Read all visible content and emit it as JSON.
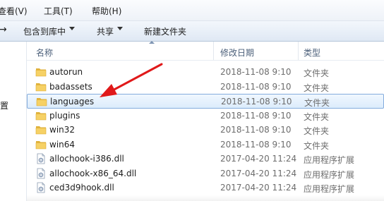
{
  "menubar": {
    "items": [
      "查看(V)",
      "工具(T)",
      "帮助(H)"
    ]
  },
  "toolbar": {
    "include_library": "包含到库中",
    "share": "共享",
    "new_folder": "新建文件夹"
  },
  "left_pane": {
    "partial_text": "置"
  },
  "columns": {
    "name": "名称",
    "modified": "修改日期",
    "type": "类型"
  },
  "rows": [
    {
      "name": "autorun",
      "modified": "2018-11-08 9:10",
      "type": "文件夹",
      "icon": "folder-icon"
    },
    {
      "name": "badassets",
      "modified": "2018-11-08 9:10",
      "type": "文件夹",
      "icon": "folder-icon"
    },
    {
      "name": "languages",
      "modified": "2018-11-08 9:10",
      "type": "文件夹",
      "icon": "folder-icon",
      "selected": true
    },
    {
      "name": "plugins",
      "modified": "2018-11-08 9:10",
      "type": "文件夹",
      "icon": "folder-icon"
    },
    {
      "name": "win32",
      "modified": "2018-11-08 9:10",
      "type": "文件夹",
      "icon": "folder-icon"
    },
    {
      "name": "win64",
      "modified": "2018-11-08 9:10",
      "type": "文件夹",
      "icon": "folder-icon"
    },
    {
      "name": "allochook-i386.dll",
      "modified": "2017-04-20 11:24",
      "type": "应用程序扩展",
      "icon": "dll-file-icon"
    },
    {
      "name": "allochook-x86_64.dll",
      "modified": "2017-04-20 11:24",
      "type": "应用程序扩展",
      "icon": "dll-file-icon"
    },
    {
      "name": "ced3d9hook.dll",
      "modified": "2017-04-20 11:24",
      "type": "应用程序扩展",
      "icon": "dll-file-icon"
    }
  ],
  "colors": {
    "arrow": "#e0191a",
    "selection_border": "#84acdd",
    "folder": "#f0c44c"
  }
}
